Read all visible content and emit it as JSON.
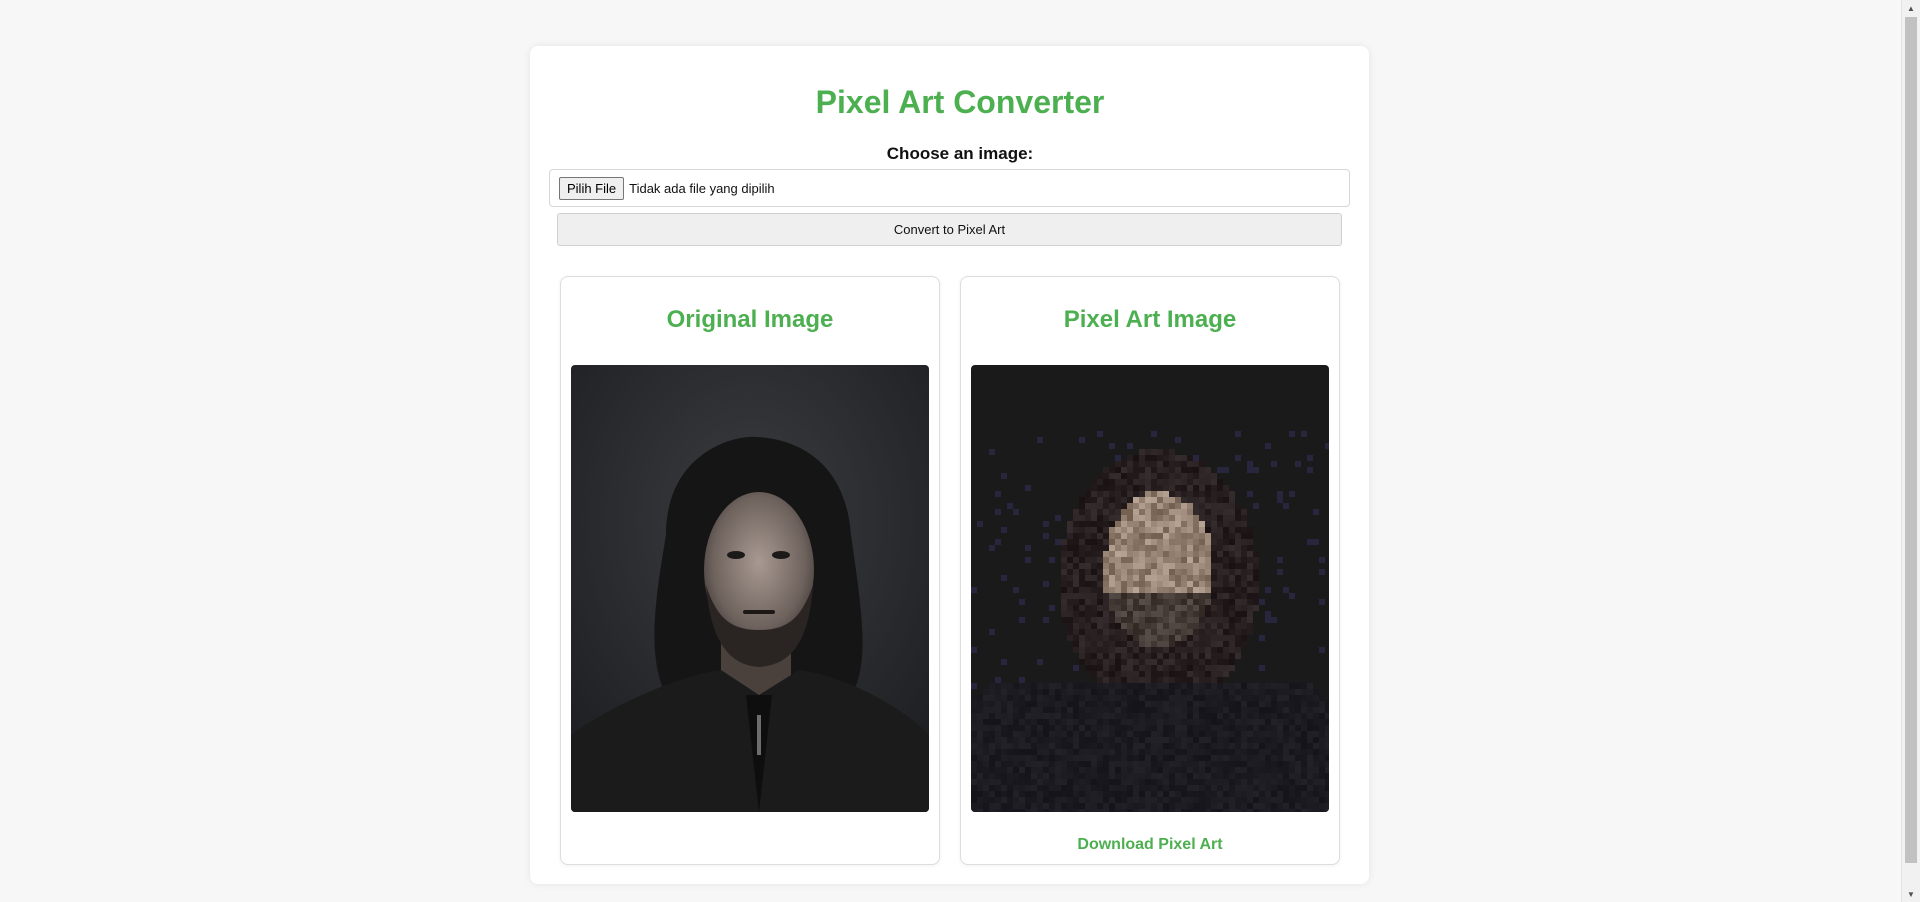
{
  "app": {
    "title": "Pixel Art Converter",
    "accent_color": "#4caf50"
  },
  "upload": {
    "label": "Choose an image:",
    "file_button_label": "Pilih File",
    "file_status": "Tidak ada file yang dipilih",
    "convert_button_label": "Convert to Pixel Art"
  },
  "panels": {
    "original": {
      "title": "Original Image",
      "image_content": "portrait photo of a man with long dark hair and beard in black jacket"
    },
    "pixel_art": {
      "title": "Pixel Art Image",
      "image_content": "pixelated version of the portrait",
      "download_label": "Download Pixel Art"
    }
  },
  "icons": {
    "scroll_up": "chevron-up-icon",
    "scroll_down": "chevron-down-icon"
  }
}
